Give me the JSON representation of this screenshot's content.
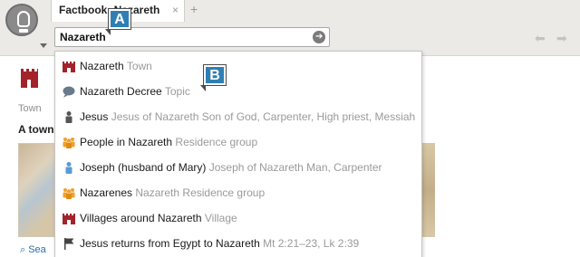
{
  "tab": {
    "title": "Factbook: Nazareth",
    "close_glyph": "×",
    "new_glyph": "+"
  },
  "search": {
    "value": "Nazareth",
    "go_glyph": "➔"
  },
  "nav": {
    "back_glyph": "⬅",
    "forward_glyph": "➡"
  },
  "page": {
    "label": "Town",
    "description": "A town",
    "search_link": "Sea"
  },
  "badges": {
    "a": "A",
    "b": "B"
  },
  "colors": {
    "castle": "#a3232b",
    "group": "#f0a030",
    "person": "#555555",
    "person_blue": "#5b9bd5",
    "topic": "#6a7a8a",
    "badge": "#2f7fb5"
  },
  "results": [
    {
      "icon": "castle-icon",
      "main": "Nazareth",
      "sub": "Town"
    },
    {
      "icon": "speech-bubble-icon",
      "main": "Nazareth Decree",
      "sub": "Topic"
    },
    {
      "icon": "person-icon",
      "main": "Jesus",
      "sub": "Jesus of Nazareth  Son of God, Carpenter, High priest, Messiah"
    },
    {
      "icon": "group-icon",
      "main": "People in Nazareth",
      "sub": "Residence group"
    },
    {
      "icon": "person-blue-icon",
      "main": "Joseph (husband of Mary)",
      "sub": "Joseph of Nazareth  Man, Carpenter"
    },
    {
      "icon": "group-icon",
      "main": "Nazarenes",
      "sub": "Nazareth  Residence group"
    },
    {
      "icon": "castle-icon",
      "main": "Villages around Nazareth",
      "sub": "Village"
    },
    {
      "icon": "flag-icon",
      "main": "Jesus returns from Egypt to Nazareth",
      "sub": "Mt 2:21–23, Lk 2:39"
    }
  ]
}
